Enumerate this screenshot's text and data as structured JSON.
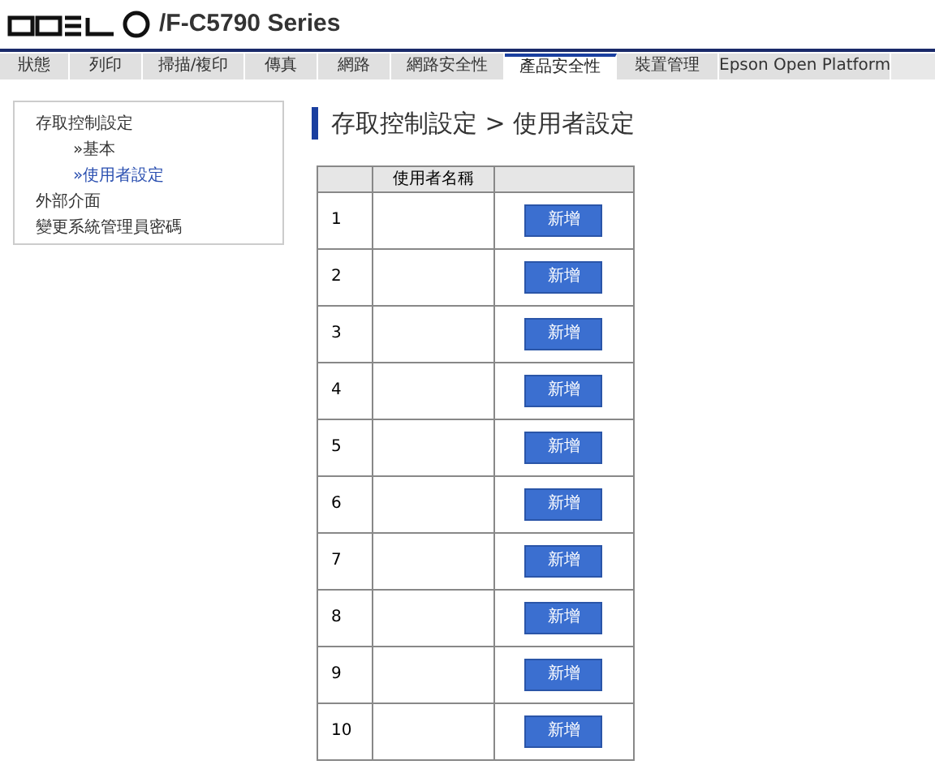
{
  "header": {
    "title": "/F-C5790 Series"
  },
  "tabs": [
    {
      "label": "狀態",
      "selected": false
    },
    {
      "label": "列印",
      "selected": false
    },
    {
      "label": "掃描/複印",
      "selected": false
    },
    {
      "label": "傳真",
      "selected": false
    },
    {
      "label": "網路",
      "selected": false
    },
    {
      "label": "網路安全性",
      "selected": false
    },
    {
      "label": "產品安全性",
      "selected": true
    },
    {
      "label": "裝置管理",
      "selected": false
    },
    {
      "label": "Epson Open Platform",
      "selected": false
    }
  ],
  "sidebar": {
    "items": [
      {
        "label": "存取控制設定",
        "selected": false,
        "children": [
          {
            "label": "»基本",
            "selected": false
          },
          {
            "label": "»使用者設定",
            "selected": true
          }
        ]
      },
      {
        "label": "外部介面",
        "selected": false
      },
      {
        "label": "變更系統管理員密碼",
        "selected": false
      }
    ]
  },
  "page_title": "存取控制設定 > 使用者設定",
  "table": {
    "columns": [
      "",
      "使用者名稱",
      ""
    ],
    "rows": [
      {
        "index": "1",
        "button": "新增"
      },
      {
        "index": "2",
        "button": "新增"
      },
      {
        "index": "3",
        "button": "新增"
      },
      {
        "index": "4",
        "button": "新增"
      },
      {
        "index": "5",
        "button": "新增"
      },
      {
        "index": "6",
        "button": "新增"
      },
      {
        "index": "7",
        "button": "新增"
      },
      {
        "index": "8",
        "button": "新增"
      },
      {
        "index": "9",
        "button": "新增"
      },
      {
        "index": "10",
        "button": "新增"
      }
    ]
  }
}
